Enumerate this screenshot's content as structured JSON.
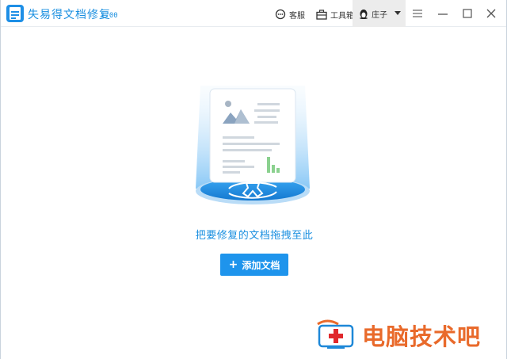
{
  "app": {
    "title": "失易得文档修复",
    "version": "1.00"
  },
  "toolbar": {
    "service_label": "客服",
    "toolbox_label": "工具箱",
    "user_label": "庄子"
  },
  "main": {
    "drop_hint": "把要修复的文档拖拽至此",
    "add_button_label": "添加文档"
  },
  "watermark": {
    "text": "电脑技术吧"
  },
  "colors": {
    "accent": "#1e94ec",
    "title_blue": "#1a8fe0",
    "watermark_orange": "#e96a2b"
  },
  "icons": {
    "service": "chat-bubble-icon",
    "toolbox": "toolbox-icon",
    "user": "penguin-icon",
    "menu": "hamburger-menu-icon",
    "minimize": "minimize-icon",
    "maximize": "maximize-icon",
    "close": "close-icon"
  }
}
